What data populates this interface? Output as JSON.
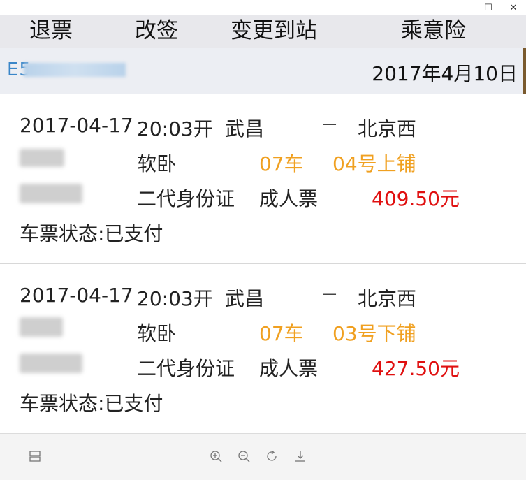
{
  "window": {
    "controls": {
      "minimize": "–",
      "maximize": "☐",
      "close": "✕"
    }
  },
  "menu": {
    "refund": "退票",
    "reschedule": "改签",
    "change_station": "变更到站",
    "insurance": "乘意险"
  },
  "order": {
    "number_visible": "E5",
    "date": "2017年4月10日"
  },
  "tickets": [
    {
      "date": "2017-04-17",
      "depart_time": "20:03开",
      "from": "武昌",
      "arrow": "—",
      "to": "北京西",
      "seat_class": "软卧",
      "car": "07车",
      "berth": "04号上铺",
      "id_type": "二代身份证",
      "ticket_type": "成人票",
      "price": "409.50元",
      "status": "车票状态:已支付"
    },
    {
      "date": "2017-04-17",
      "depart_time": "20:03开",
      "from": "武昌",
      "arrow": "—",
      "to": "北京西",
      "seat_class": "软卧",
      "car": "07车",
      "berth": "03号下铺",
      "id_type": "二代身份证",
      "ticket_type": "成人票",
      "price": "427.50元",
      "status": "车票状态:已支付"
    }
  ],
  "colors": {
    "accent_orange": "#f0a020",
    "price_red": "#e01010",
    "order_blue": "#3a86c8",
    "menu_bg": "#e8e8ec"
  },
  "toolbar": {
    "icons": [
      "layout-icon",
      "zoom-in-icon",
      "zoom-out-icon",
      "rotate-icon",
      "download-icon"
    ]
  }
}
